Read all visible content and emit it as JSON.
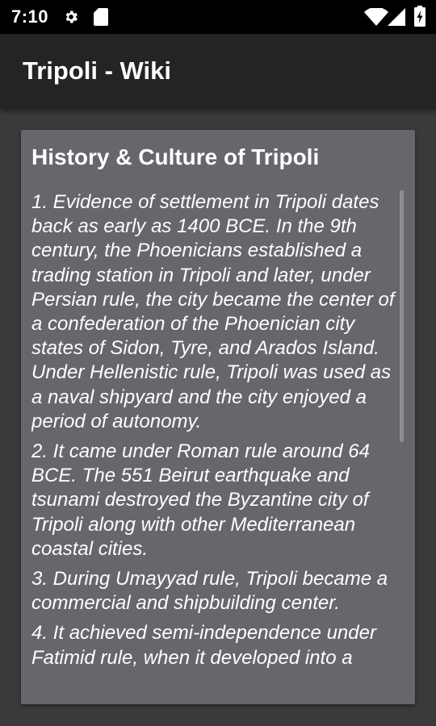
{
  "status_bar": {
    "time": "7:10",
    "icons": [
      "gear-icon",
      "sd-card-icon",
      "wifi-icon",
      "signal-icon",
      "battery-icon"
    ]
  },
  "app_bar": {
    "title": "Tripoli - Wiki"
  },
  "article": {
    "title": "History & Culture of Tripoli",
    "paragraphs": [
      "1. Evidence of settlement in Tripoli dates back as early as 1400 BCE. In the 9th century, the Phoenicians established a trading station in Tripoli and later, under Persian rule, the city became the center of a confederation of the Phoenician city states of Sidon, Tyre, and Arados Island. Under Hellenistic rule, Tripoli was used as a naval shipyard and the city enjoyed a period of autonomy.",
      "2. It came under Roman rule around 64 BCE. The 551 Beirut earthquake and tsunami destroyed the Byzantine city of Tripoli along with other Mediterranean coastal cities.",
      "3. During Umayyad rule, Tripoli became a commercial and shipbuilding center.",
      "4. It achieved semi-independence under Fatimid rule, when it developed into a"
    ]
  },
  "colors": {
    "status_bar": "#000000",
    "app_bar": "#242424",
    "background": "#3a3a3c",
    "card": "#66666c",
    "text": "#ffffff"
  }
}
